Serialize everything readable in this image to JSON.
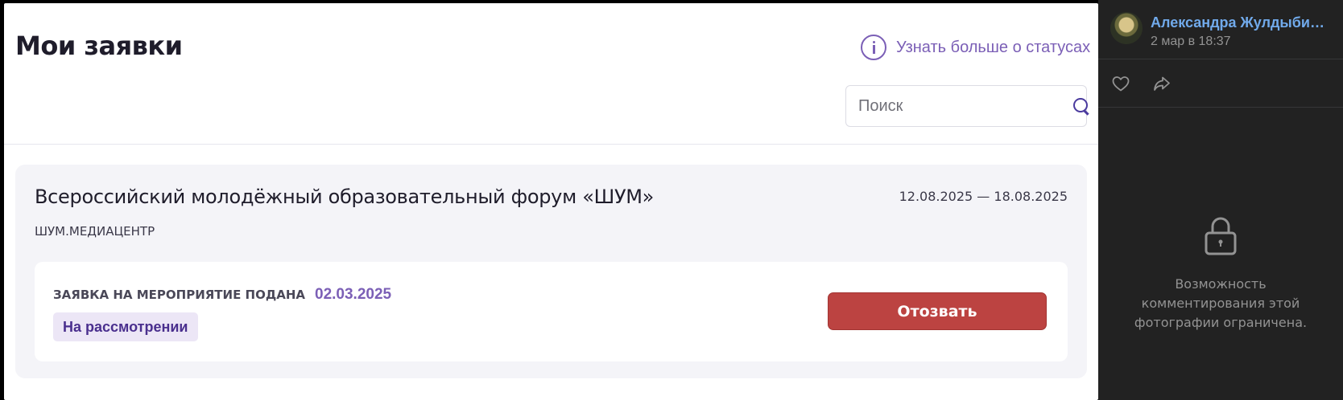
{
  "photo": {
    "page_title": "Мои заявки",
    "status_link": "Узнать больше о статусах",
    "search": {
      "placeholder": "Поиск",
      "value": ""
    },
    "event": {
      "title": "Всероссийский молодёжный образовательный форум «ШУМ»",
      "dates": "12.08.2025 — 18.08.2025",
      "organization": "ШУМ.МЕДИАЦЕНТР",
      "application": {
        "status_label": "ЗАЯВКА НА МЕРОПРИЯТИЕ ПОДАНА",
        "date": "02.03.2025",
        "badge": "На рассмотрении",
        "withdraw_label": "Отозвать"
      }
    }
  },
  "sidebar": {
    "author_name": "Александра Жулдыбина",
    "post_time": "2 мар в 18:37",
    "actions": {
      "like_icon": "heart-icon",
      "share_icon": "share-arrow-icon"
    },
    "comments_restricted_text": "Возможность комментирования этой фотографии ограничена."
  },
  "colors": {
    "accent_purple": "#7b5fb6",
    "withdraw_red": "#bc4341",
    "sidebar_bg": "#222222",
    "link_blue": "#71aaeb"
  }
}
